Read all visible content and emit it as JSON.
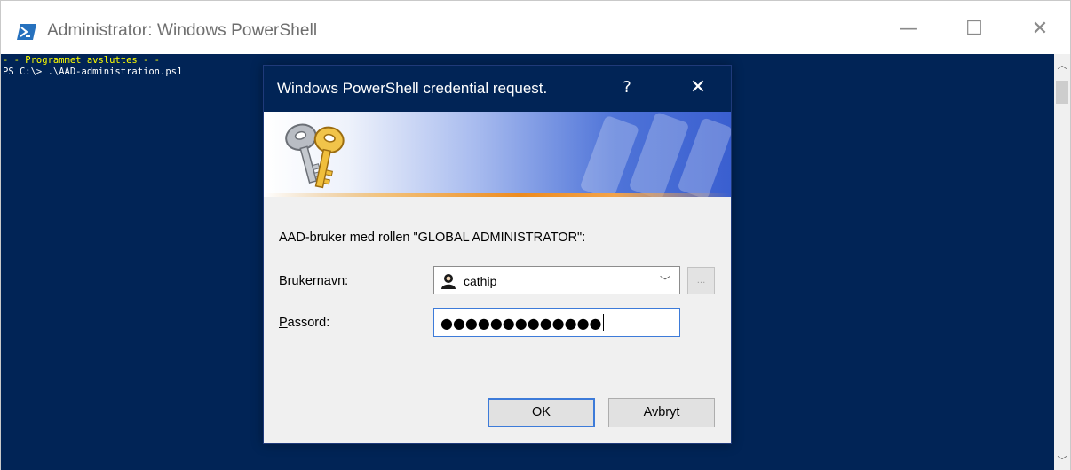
{
  "window": {
    "title": "Administrator: Windows PowerShell",
    "controls": {
      "minimize": "—",
      "maximize": "☐",
      "close": "✕"
    }
  },
  "console": {
    "lines": [
      "- - Programmet avsluttes - -",
      "PS C:\\> .\\AAD-administration.ps1"
    ],
    "colors": {
      "background": "#012456",
      "highlight": "#ffff00",
      "text": "#ffffff"
    }
  },
  "scrollbar": {
    "up": "︿",
    "down": "﹀"
  },
  "dialog": {
    "title": "Windows PowerShell credential request.",
    "help": "?",
    "close": "✕",
    "banner_icon": "keys-icon",
    "prompt": "AAD-bruker med rollen \"GLOBAL ADMINISTRATOR\":",
    "username": {
      "label_accel": "B",
      "label_rest": "rukernavn:",
      "value": "cathip",
      "icon": "user-icon",
      "dropdown": "﹀",
      "browse": "..."
    },
    "password": {
      "label_accel": "P",
      "label_rest": "assord:",
      "value": "●●●●●●●●●●●●●"
    },
    "buttons": {
      "ok": "OK",
      "cancel": "Avbryt"
    }
  }
}
